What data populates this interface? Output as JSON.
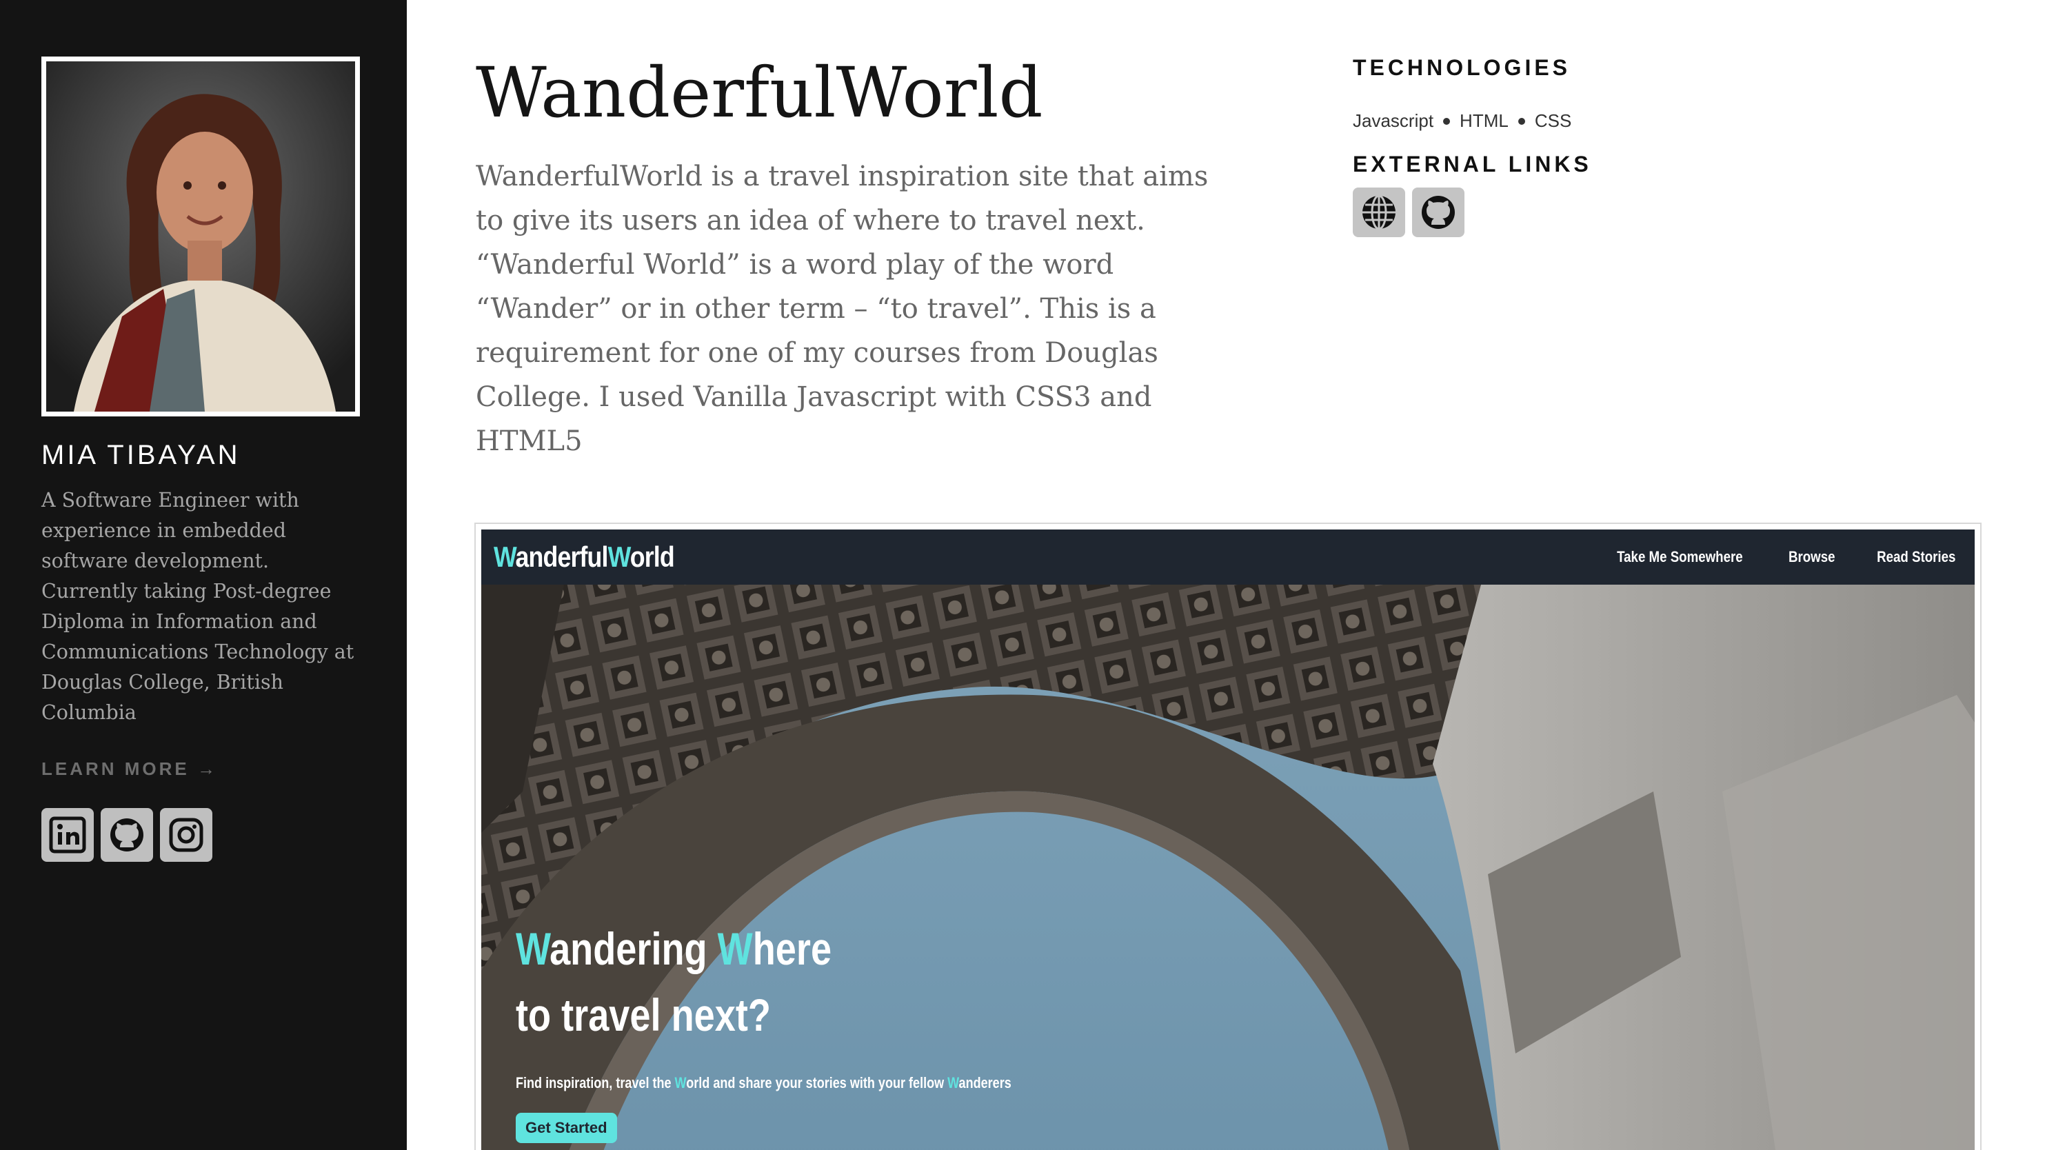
{
  "sidebar": {
    "author_name": "MIA TIBAYAN",
    "bio": "A Software Engineer with experience in embedded software development. Currently taking Post-degree Diploma in Information and Communications Technology at Douglas College, British Columbia",
    "learn_more": "LEARN MORE →",
    "social": [
      {
        "icon": "linkedin-icon"
      },
      {
        "icon": "github-icon"
      },
      {
        "icon": "instagram-icon"
      }
    ]
  },
  "project": {
    "title": "WanderfulWorld",
    "description": "WanderfulWorld is a travel inspiration site that aims to give its users an idea of where to travel next. “Wanderful World” is a word play of the word “Wander” or in other term – “to travel”. This is a requirement for one of my courses from Douglas College. I used Vanilla Javascript with CSS3 and HTML5",
    "technologies_heading": "TECHNOLOGIES",
    "technologies": [
      "Javascript",
      "HTML",
      "CSS"
    ],
    "external_links_heading": "EXTERNAL LINKS",
    "external_links": [
      {
        "icon": "globe-icon"
      },
      {
        "icon": "github-icon"
      }
    ]
  },
  "preview": {
    "logo_parts": [
      "W",
      "anderful",
      "W",
      "orld"
    ],
    "nav": [
      "Take Me Somewhere",
      "Browse",
      "Read Stories"
    ],
    "hero_title_parts": [
      "W",
      "andering ",
      "W",
      "here"
    ],
    "hero_title_line2": "to travel next?",
    "hero_sub_parts": [
      "Find inspiration, travel the ",
      "W",
      "orld and share your stories with your fellow ",
      "W",
      "anderers"
    ],
    "cta": "Get Started"
  },
  "colors": {
    "sidebar_bg": "#141414",
    "accent": "#5fe3df",
    "preview_nav_bg": "#1f2630"
  }
}
